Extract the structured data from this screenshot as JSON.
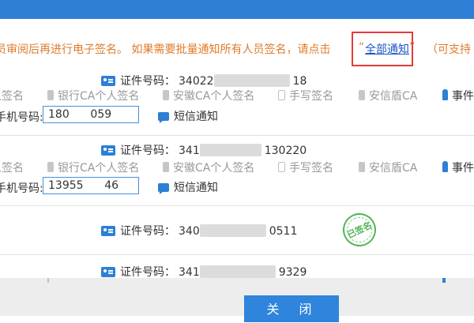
{
  "notice": {
    "text_before": "员审阅后再进行电子签名。 如果需要批量通知所有人员签名，请点击",
    "quote_open": "“",
    "link": "全部通知",
    "quote_close": "”",
    "text_after": "（可支持"
  },
  "rows": [
    {
      "id_label": "证件号码：",
      "id_prefix": "34022",
      "id_suffix": "18",
      "options": [
        "人签名",
        "银行CA个人签名",
        "安徽CA个人签名",
        "手写签名",
        "安信盾CA",
        "事件"
      ],
      "phone_label": "手机号码:",
      "phone_value": "180      059",
      "sms_label": "短信通知"
    },
    {
      "id_label": "证件号码：",
      "id_prefix": "341",
      "id_suffix": "130220",
      "options": [
        "人签名",
        "银行CA个人签名",
        "安徽CA个人签名",
        "手写签名",
        "安信盾CA",
        "事件"
      ],
      "phone_label": "手机号码:",
      "phone_value": "13955      46",
      "sms_label": "短信通知"
    },
    {
      "id_label": "证件号码：",
      "id_prefix": "340",
      "id_suffix": "0511",
      "stamp_text": "已签名"
    },
    {
      "id_label": "证件号码：",
      "id_prefix": "341",
      "id_suffix": "9329"
    }
  ],
  "footer": {
    "close_label": "关 闭"
  },
  "colors": {
    "accent": "#2f85dc",
    "warning_text": "#e07b2a",
    "highlight_box": "#e33a3a",
    "stamp": "#52b558"
  }
}
